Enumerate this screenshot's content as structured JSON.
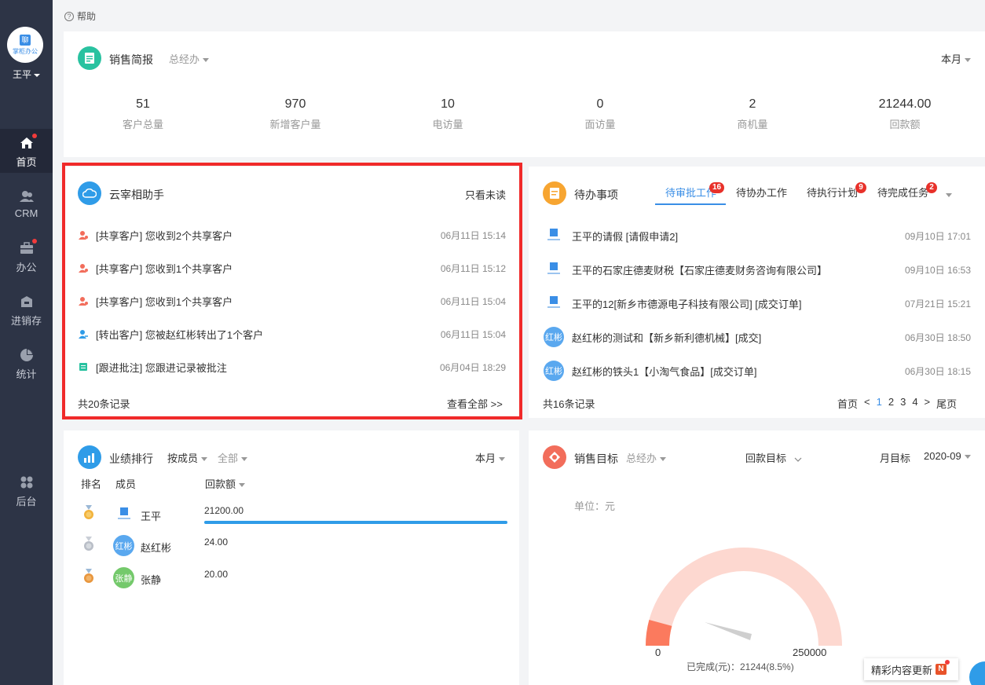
{
  "sidebar": {
    "logo_text": "掌柜办公",
    "logo_mark": "聊",
    "user": "王平",
    "items": [
      {
        "label": "首页",
        "icon": "home-icon",
        "dot": true
      },
      {
        "label": "CRM",
        "icon": "crm-icon",
        "dot": false
      },
      {
        "label": "办公",
        "icon": "briefcase-icon",
        "dot": true
      },
      {
        "label": "进销存",
        "icon": "warehouse-icon",
        "dot": false
      },
      {
        "label": "统计",
        "icon": "pie-chart-icon",
        "dot": false
      },
      {
        "label": "后台",
        "icon": "admin-grid-icon",
        "dot": false
      }
    ]
  },
  "help": {
    "label": "帮助"
  },
  "sales_brief": {
    "title": "销售简报",
    "scope": "总经办",
    "period": "本月",
    "stats": [
      {
        "value": "51",
        "label": "客户总量"
      },
      {
        "value": "970",
        "label": "新增客户量"
      },
      {
        "value": "10",
        "label": "电访量"
      },
      {
        "value": "0",
        "label": "面访量"
      },
      {
        "value": "2",
        "label": "商机量"
      },
      {
        "value": "21244.00",
        "label": "回款额"
      }
    ]
  },
  "assistant": {
    "title": "云宰相助手",
    "filter": "只看未读",
    "messages": [
      {
        "text": "[共享客户] 您收到2个共享客户",
        "time": "06月11日 15:14",
        "icon": "share-customer-icon"
      },
      {
        "text": "[共享客户] 您收到1个共享客户",
        "time": "06月11日 15:12",
        "icon": "share-customer-icon"
      },
      {
        "text": "[共享客户] 您收到1个共享客户",
        "time": "06月11日 15:04",
        "icon": "share-customer-icon"
      },
      {
        "text": "[转出客户] 您被赵红彬转出了1个客户",
        "time": "06月11日 15:04",
        "icon": "transfer-customer-icon"
      },
      {
        "text": "[跟进批注] 您跟进记录被批注",
        "time": "06月04日 18:29",
        "icon": "annotation-icon"
      }
    ],
    "total": "共20条记录",
    "view_all": "查看全部 >>"
  },
  "todo": {
    "title": "待办事项",
    "tabs": [
      {
        "label": "待审批工作",
        "badge": "16"
      },
      {
        "label": "待协办工作",
        "badge": ""
      },
      {
        "label": "待执行计划",
        "badge": "9"
      },
      {
        "label": "待完成任务",
        "badge": "2"
      }
    ],
    "items": [
      {
        "text": "王平的请假 [请假申请2]",
        "time": "09月10日 17:01",
        "avatar": "logo"
      },
      {
        "text": "王平的石家庄德麦财税【石家庄德麦财务咨询有限公司】",
        "time": "09月10日 16:53",
        "avatar": "logo"
      },
      {
        "text": "王平的12[新乡市德源电子科技有限公司] [成交订单]",
        "time": "07月21日 15:21",
        "avatar": "logo"
      },
      {
        "text": "赵红彬的测试和【新乡新利德机械】[成交]",
        "time": "06月30日 18:50",
        "avatar": "红彬"
      },
      {
        "text": "赵红彬的铁头1【小淘气食品】[成交订单]",
        "time": "06月30日 18:15",
        "avatar": "红彬"
      }
    ],
    "total": "共16条记录",
    "pager": {
      "first": "首页",
      "prev": "<",
      "pages": [
        "1",
        "2",
        "3",
        "4"
      ],
      "current": "1",
      "next": ">",
      "last": "尾页"
    }
  },
  "ranking": {
    "title": "业绩排行",
    "by": "按成员",
    "scope": "全部",
    "period": "本月",
    "col_rank": "排名",
    "col_member": "成员",
    "col_value": "回款额",
    "rows": [
      {
        "name": "王平",
        "value": "21200.00",
        "avatar": "logo",
        "medal": "gold",
        "share": 1.0
      },
      {
        "name": "赵红彬",
        "value": "24.00",
        "avatar": "红彬",
        "medal": "silver",
        "share": 0.0011
      },
      {
        "name": "张静",
        "value": "20.00",
        "avatar": "张静",
        "medal": "bronze",
        "share": 0.0009
      }
    ]
  },
  "sales_target": {
    "title": "销售目标",
    "scope": "总经办",
    "target_type": "回款目标",
    "period_type": "月目标",
    "month": "2020-09",
    "unit": "单位：元",
    "min": "0",
    "max": "250000",
    "completed_label": "已完成(元)：21244(8.5%)",
    "progress": 0.085
  },
  "float_tip": {
    "label": "精彩内容更新",
    "badge": "N"
  },
  "colors": {
    "primary": "#3a8ee6",
    "sidebar": "#2d3446",
    "highlight": "#f02a2a",
    "gauge_bg": "#fdd8d0",
    "gauge_fill": "#fb7a5e"
  }
}
